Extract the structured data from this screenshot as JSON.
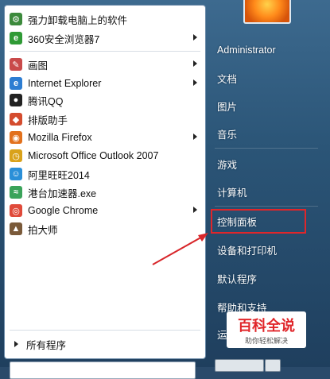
{
  "programs": [
    {
      "label": "强力卸载电脑上的软件",
      "icon": "uninstall-icon",
      "color": "#3c8a3c",
      "submenu": false
    },
    {
      "label": "360安全浏览器7",
      "icon": "360-browser-icon",
      "color": "#2f9a35",
      "submenu": true
    },
    {
      "label": "画图",
      "icon": "paint-icon",
      "color": "#c94a4a",
      "submenu": true
    },
    {
      "label": "Internet Explorer",
      "icon": "ie-icon",
      "color": "#2d7dd2",
      "submenu": true
    },
    {
      "label": "腾讯QQ",
      "icon": "qq-penguin-icon",
      "color": "#222222",
      "submenu": false
    },
    {
      "label": "排版助手",
      "icon": "typesetting-icon",
      "color": "#d44c2e",
      "submenu": false
    },
    {
      "label": "Mozilla Firefox",
      "icon": "firefox-icon",
      "color": "#e2711d",
      "submenu": true
    },
    {
      "label": "Microsoft Office Outlook 2007",
      "icon": "outlook-icon",
      "color": "#d9a21b",
      "submenu": false
    },
    {
      "label": "阿里旺旺2014",
      "icon": "aliwangwang-icon",
      "color": "#2a8fd8",
      "submenu": false
    },
    {
      "label": "港台加速器.exe",
      "icon": "accelerator-icon",
      "color": "#3aa35a",
      "submenu": false
    },
    {
      "label": "Google Chrome",
      "icon": "chrome-icon",
      "color": "#e04a3a",
      "submenu": true
    },
    {
      "label": "拍大师",
      "icon": "paidashi-icon",
      "color": "#7a5a3a",
      "submenu": false
    }
  ],
  "all_programs": "所有程序",
  "right": [
    {
      "label": "Administrator"
    },
    {
      "label": "文档"
    },
    {
      "label": "图片"
    },
    {
      "label": "音乐"
    },
    {
      "label": "游戏"
    },
    {
      "label": "计算机"
    },
    {
      "label": "控制面板"
    },
    {
      "label": "设备和打印机"
    },
    {
      "label": "默认程序"
    },
    {
      "label": "帮助和支持"
    },
    {
      "label": "运"
    }
  ],
  "watermark": {
    "main": "百科全说",
    "sub": "助你轻松解决"
  },
  "colors": {
    "highlight": "#e0262a"
  }
}
